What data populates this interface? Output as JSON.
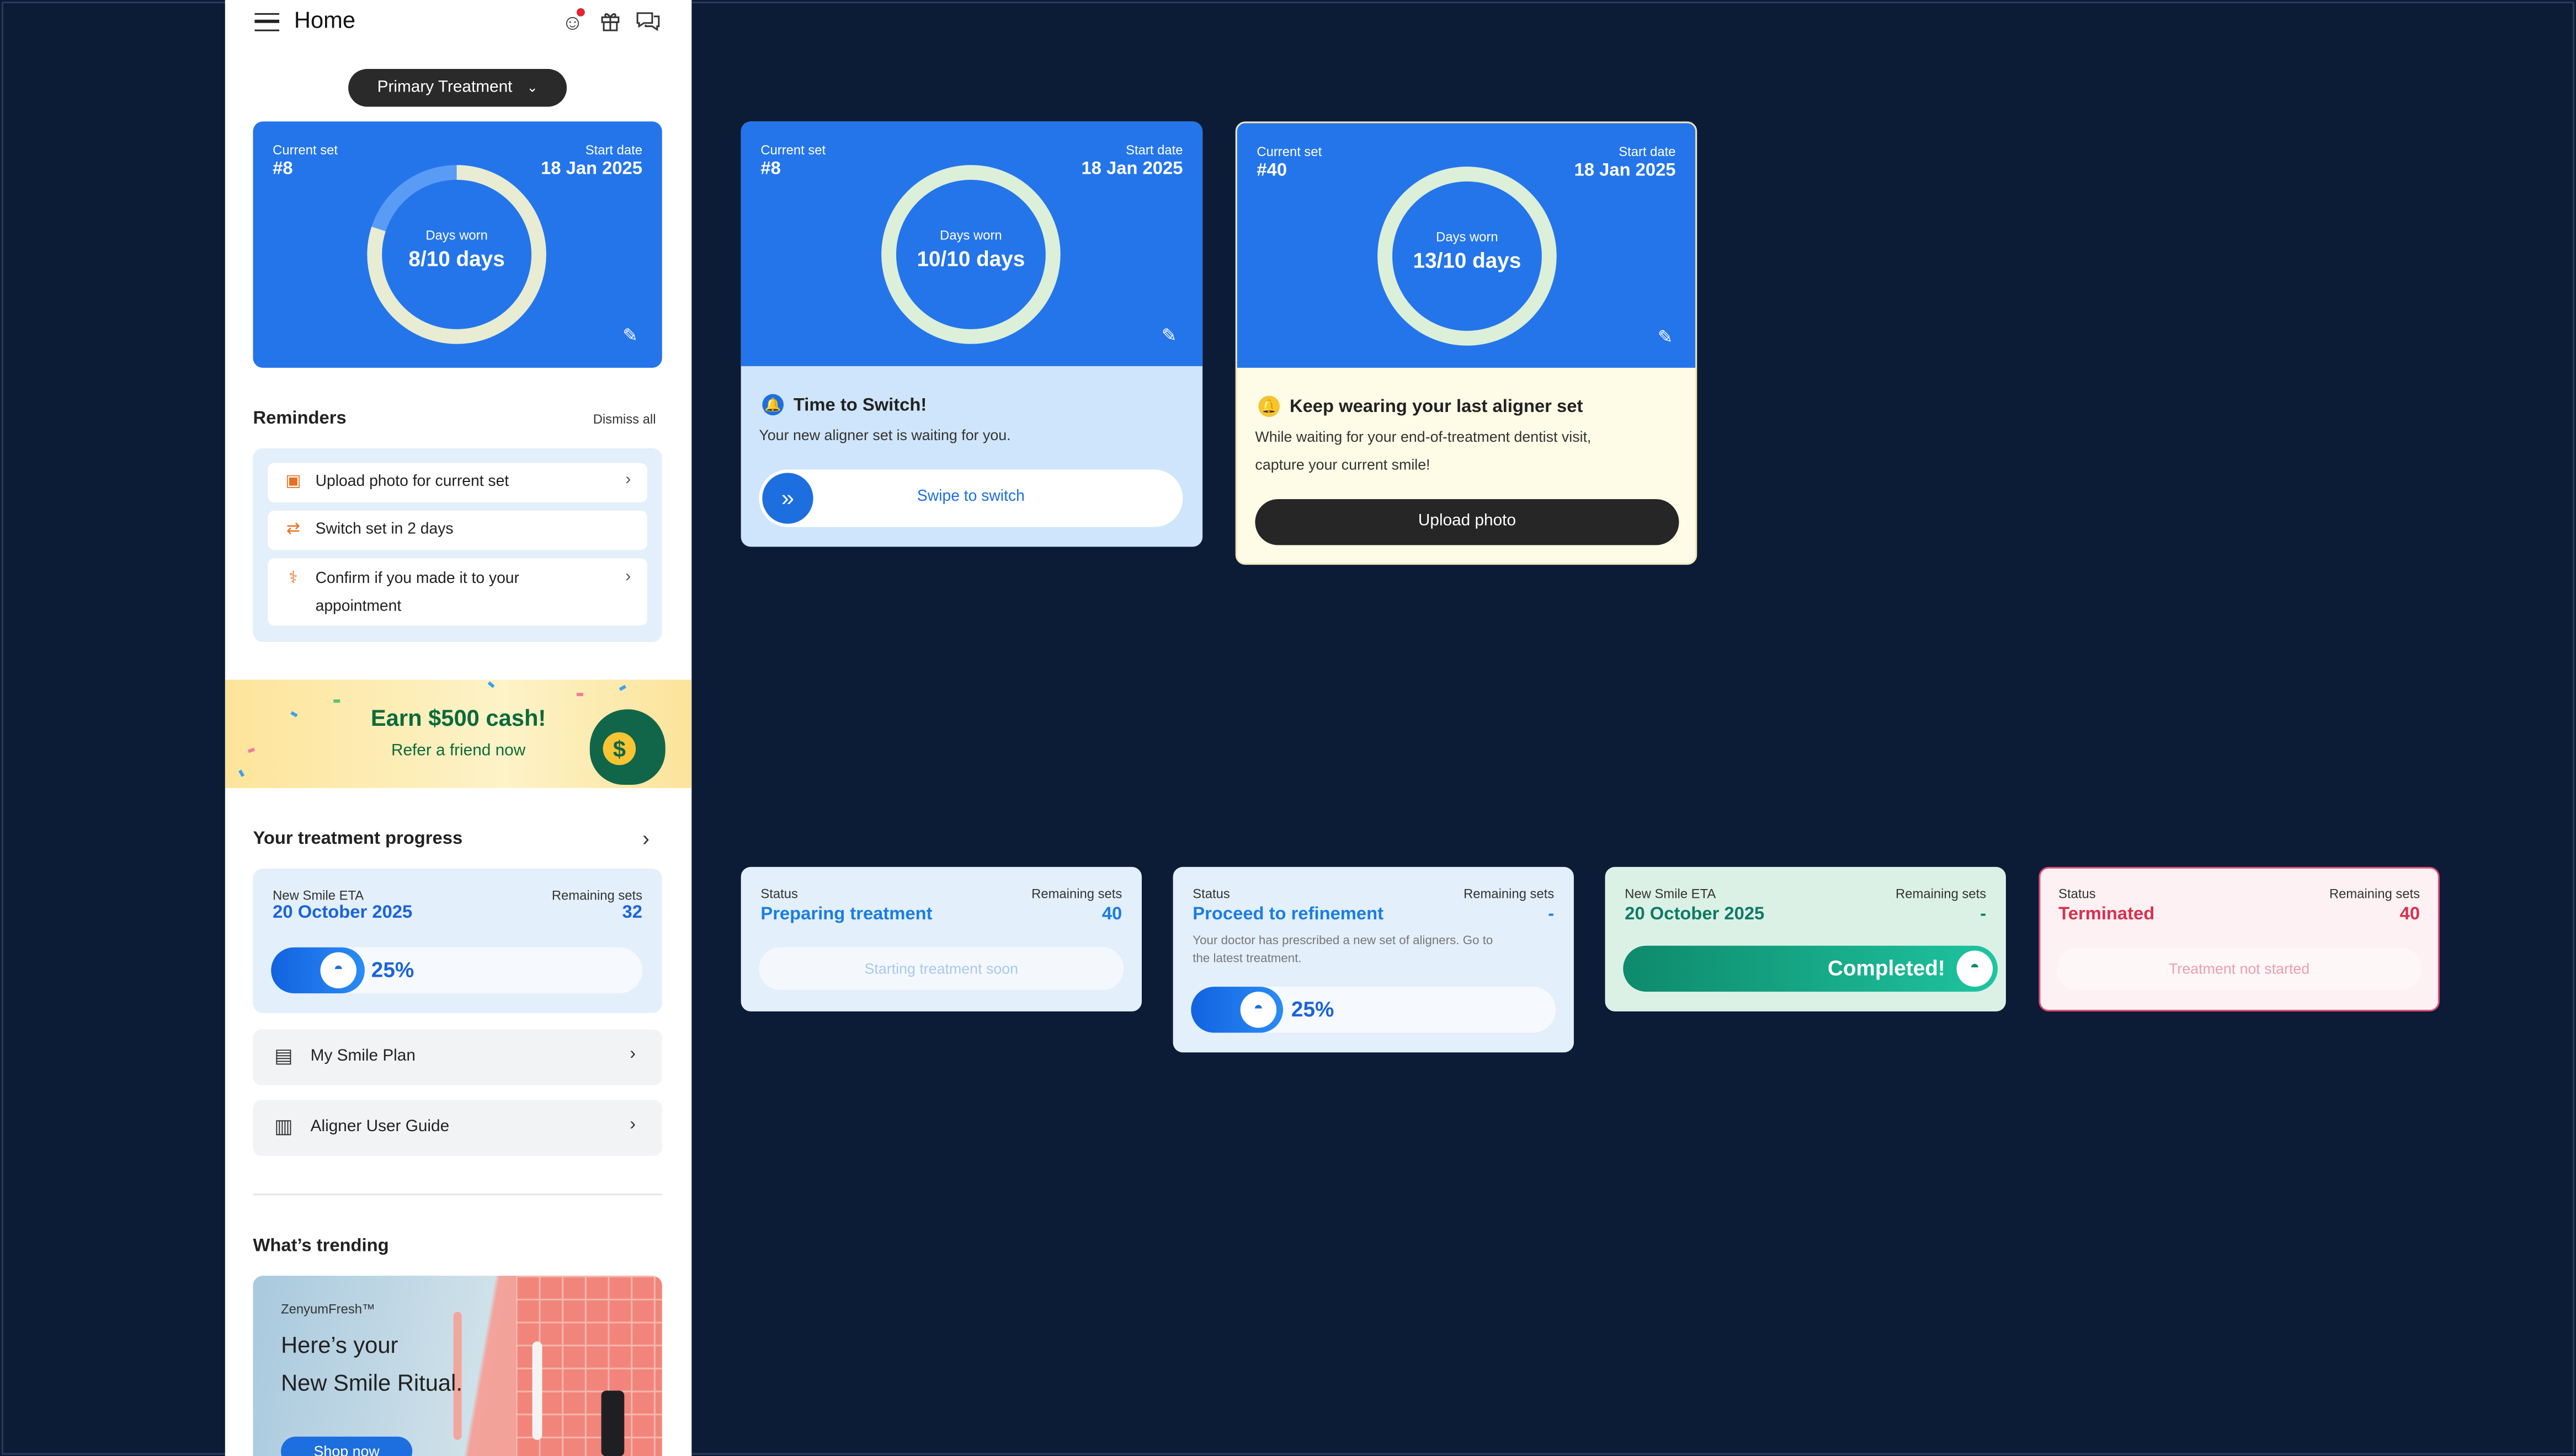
{
  "colors": {
    "page_bg": "#0c1b36",
    "brand_blue": "#2475ea",
    "text_blue": "#1a7ee0",
    "teal": "#0e7a66",
    "terminated": "#d6314f"
  },
  "header": {
    "title": "Home",
    "icons": [
      "emoji-icon",
      "gift-icon",
      "chat-icon"
    ]
  },
  "treatment_selector": {
    "label": "Primary Treatment",
    "icon": "chevron-down-icon"
  },
  "aligner_card": {
    "current_set_label": "Current set",
    "current_set": "#8",
    "start_date_label": "Start date",
    "start_date": "18 Jan 2025",
    "days_worn_label": "Days worn",
    "days_worn": "8/10 days",
    "days_worn_fraction": 0.8
  },
  "reminders": {
    "title": "Reminders",
    "dismiss_label": "Dismiss all",
    "items": [
      {
        "label": "Upload photo for current set",
        "icon": "photo-icon"
      },
      {
        "label": "Switch set in 2 days",
        "icon": "switch-icon"
      },
      {
        "label": "Confirm if you made it to your appointment",
        "line1": "Confirm if you made it to your",
        "line2": "appointment",
        "icon": "dentist-chair-icon"
      }
    ]
  },
  "banner": {
    "title": "Earn $500 cash!",
    "subtitle": "Refer a friend now",
    "coin": "$"
  },
  "progress": {
    "title": "Your treatment progress",
    "eta_label": "New Smile ETA",
    "eta": "20 October 2025",
    "remaining_label": "Remaining sets",
    "remaining": "32",
    "percent": "25%",
    "percent_value": 0.25
  },
  "links": [
    {
      "label": "My Smile Plan",
      "icon": "document-icon"
    },
    {
      "label": "Aligner User Guide",
      "icon": "book-icon"
    }
  ],
  "trending": {
    "title": "What’s trending",
    "brand": "ZenyumFresh™",
    "headline1": "Here’s your",
    "headline2": "New Smile Ritual.",
    "cta": "Shop now"
  },
  "alert_cards": [
    {
      "current_set_label": "Current set",
      "current_set": "#8",
      "start_date_label": "Start date",
      "start_date": "18 Jan 2025",
      "days_worn_label": "Days worn",
      "days_worn": "10/10 days",
      "days_worn_fraction": 1.0,
      "title": "Time to Switch!",
      "body": "Your new aligner set is waiting for you.",
      "action": "Swipe to switch"
    },
    {
      "current_set_label": "Current set",
      "current_set": "#40",
      "start_date_label": "Start date",
      "start_date": "18 Jan 2025",
      "days_worn_label": "Days worn",
      "days_worn": "13/10 days",
      "days_worn_fraction": 1.0,
      "title": "Keep wearing your last aligner set",
      "body_line1": "While waiting for your end-of-treatment dentist visit,",
      "body_line2": "capture your current smile!",
      "action": "Upload photo"
    }
  ],
  "status_cards": [
    {
      "left_label": "Status",
      "left_value": "Preparing treatment",
      "right_label": "Remaining sets",
      "right_value": "40",
      "bar_text": "Starting treatment soon"
    },
    {
      "left_label": "Status",
      "left_value": "Proceed to refinement",
      "right_label": "Remaining sets",
      "right_value": "-",
      "note_line1": "Your doctor has prescribed a new set of aligners. Go to",
      "note_line2": "the latest treatment.",
      "percent": "25%",
      "percent_value": 0.25
    },
    {
      "left_label": "New Smile ETA",
      "left_value": "20 October 2025",
      "right_label": "Remaining sets",
      "right_value": "-",
      "bar_text": "Completed!"
    },
    {
      "left_label": "Status",
      "left_value": "Terminated",
      "right_label": "Remaining sets",
      "right_value": "40",
      "bar_text": "Treatment not started"
    }
  ]
}
